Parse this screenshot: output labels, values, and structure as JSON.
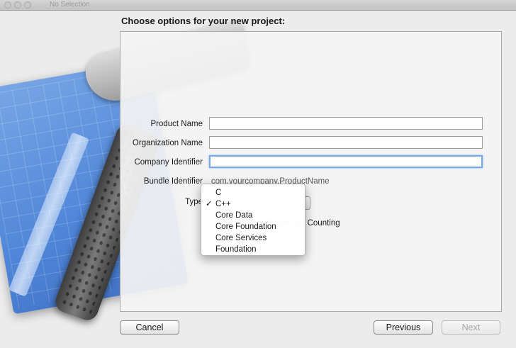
{
  "window": {
    "title": "No Selection"
  },
  "heading": "Choose options for your new project:",
  "form": {
    "product_name": {
      "label": "Product Name",
      "value": ""
    },
    "organization_name": {
      "label": "Organization Name",
      "value": ""
    },
    "company_identifier": {
      "label": "Company Identifier",
      "value": ""
    },
    "bundle_identifier": {
      "label": "Bundle Identifier",
      "value": "com.yourcompany.ProductName"
    },
    "type": {
      "label": "Type"
    },
    "arc": {
      "label": "Use Automatic Reference Counting"
    }
  },
  "type_menu": {
    "items": [
      "C",
      "C++",
      "Core Data",
      "Core Foundation",
      "Core Services",
      "Foundation"
    ],
    "selected": "C++",
    "check_mark": "✓"
  },
  "buttons": {
    "cancel": "Cancel",
    "previous": "Previous",
    "next": "Next"
  }
}
